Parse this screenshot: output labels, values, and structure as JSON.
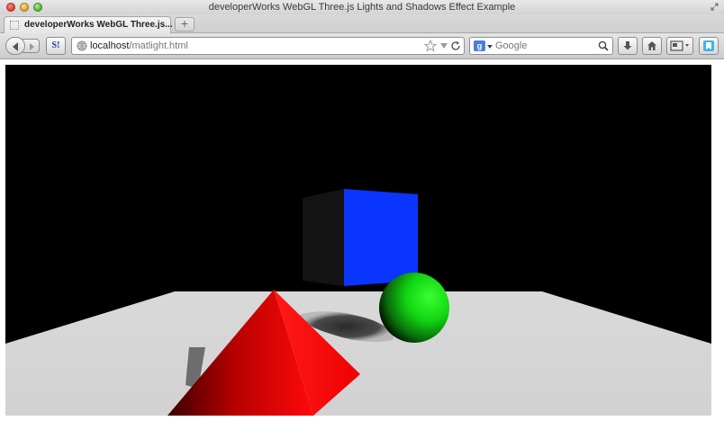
{
  "window": {
    "title": "developerWorks WebGL Three.js Lights and Shadows Effect Example"
  },
  "tabs": [
    {
      "label": "developerWorks WebGL Three.js..."
    }
  ],
  "new_tab_label": "+",
  "toolbar": {
    "extension_label": "S!"
  },
  "url": {
    "host": "localhost",
    "path": "/matlight.html"
  },
  "search": {
    "engine_label": "g",
    "placeholder": "Google"
  },
  "scene": {
    "background_color": "#000000",
    "ground_color": "#d0d0d0",
    "cube_color": "#0a35ff",
    "sphere_color": "#16e016",
    "pyramid_color": "#ff0000"
  }
}
